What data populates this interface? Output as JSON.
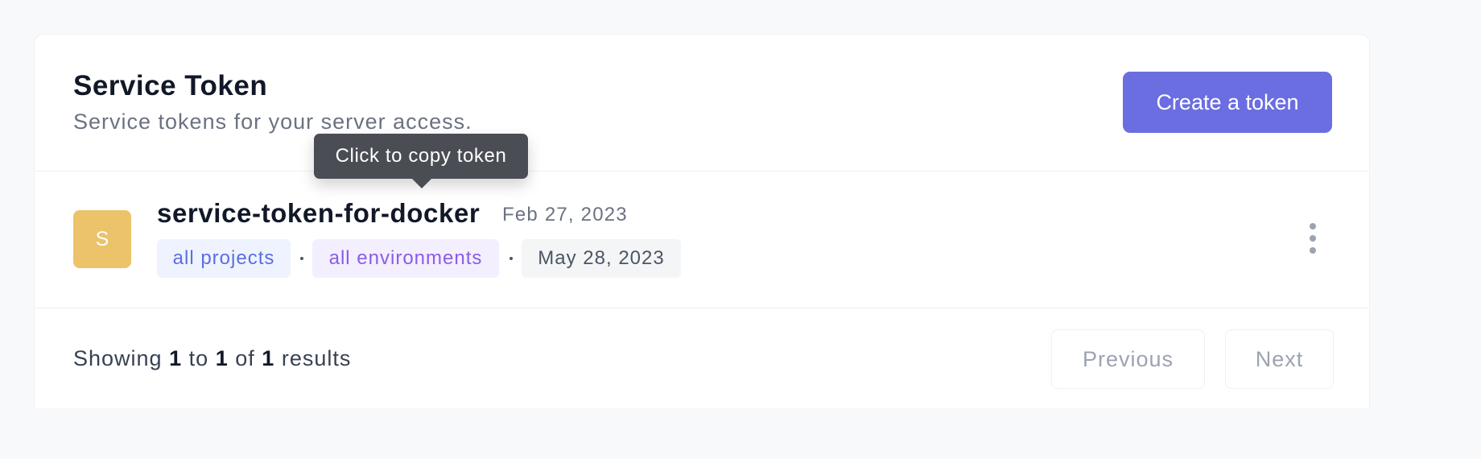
{
  "header": {
    "title": "Service Token",
    "subtitle": "Service tokens for your server access.",
    "create_label": "Create a token"
  },
  "tooltip": {
    "text": "Click to copy token"
  },
  "tokens": [
    {
      "avatar_letter": "S",
      "name": "service-token-for-docker",
      "created": "Feb 27, 2023",
      "projects_tag": "all projects",
      "environments_tag": "all environments",
      "expiry": "May 28, 2023"
    }
  ],
  "pagination": {
    "prefix": "Showing",
    "from": "1",
    "to_word": "to",
    "to": "1",
    "of_word": "of",
    "total": "1",
    "suffix": "results",
    "previous_label": "Previous",
    "next_label": "Next"
  },
  "colors": {
    "accent": "#6b6ee0",
    "avatar": "#ecc26a",
    "projects_tag_text": "#5b6ee0",
    "environments_tag_text": "#8b5ce6",
    "tooltip_bg": "#4a4d54"
  },
  "icons": {
    "row_menu": "more-vertical-icon"
  }
}
